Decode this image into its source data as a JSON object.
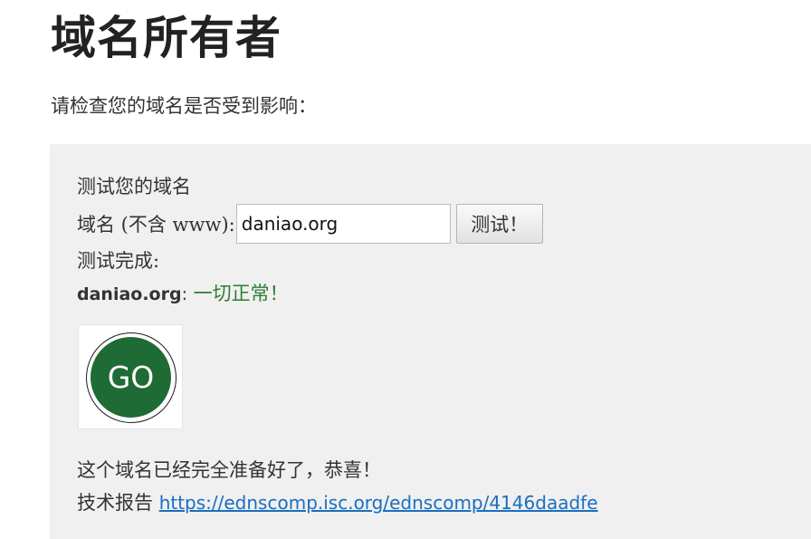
{
  "page": {
    "title": "域名所有者",
    "intro": "请检查您的域名是否受到影响："
  },
  "test": {
    "heading": "测试您的域名",
    "domain_label": "域名 (不含 www):",
    "domain_value": "daniao.org",
    "button_label": "测试！",
    "done_label": "测试完成:",
    "result_domain": "daniao.org",
    "result_colon": ":",
    "result_status": "一切正常！",
    "badge_text": "GO",
    "ready_text": "这个域名已经完全准备好了，恭喜！",
    "report_label": "技术报告",
    "report_link": "https://ednscomp.isc.org/ednscomp/4146daadfe"
  },
  "colors": {
    "panel_bg": "#f0f0f0",
    "status_green": "#2e7d32",
    "badge_green": "#1f6b35",
    "link_blue": "#1a6fc2"
  },
  "icons": {
    "badge": "go-badge-icon"
  }
}
